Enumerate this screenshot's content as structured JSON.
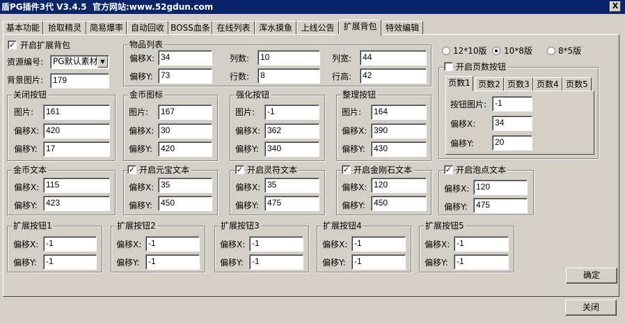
{
  "title": "盾PG插件3代 V3.4.5  官方网站:www.52gdun.com",
  "close_glyph": "X",
  "tabs": [
    "基本功能",
    "拾取精灵",
    "简易爆率",
    "自动回收",
    "BOSS血条",
    "在线列表",
    "浑水摸鱼",
    "上线公告",
    "扩展背包",
    "特效编辑"
  ],
  "active_tab": "扩展背包",
  "enable_bag": {
    "label": "开启扩展背包",
    "checked": true,
    "mark": "✓"
  },
  "resource": {
    "label": "资源编号:",
    "value": "PG默认素材",
    "arrow": "▼"
  },
  "bg_image": {
    "label": "背景图片:",
    "value": "179"
  },
  "item_list": {
    "title": "物品列表",
    "offset_x_label": "偏移X:",
    "offset_x": "34",
    "offset_y_label": "偏移Y:",
    "offset_y": "73",
    "cols_label": "列数:",
    "cols": "10",
    "rows_label": "行数:",
    "rows": "8",
    "col_width_label": "列宽:",
    "col_width": "44",
    "row_height_label": "行高:",
    "row_height": "42"
  },
  "close_button_grp": {
    "title": "关闭按钮",
    "img_label": "图片:",
    "img": "161",
    "x_label": "偏移X:",
    "x": "420",
    "y_label": "偏移Y:",
    "y": "17"
  },
  "gold_icon": {
    "title": "金币图标",
    "img_label": "图片:",
    "img": "167",
    "x_label": "偏移X:",
    "x": "30",
    "y_label": "偏移Y:",
    "y": "420"
  },
  "enhance_btn": {
    "title": "强化按钮",
    "img_label": "图片:",
    "img": "-1",
    "x_label": "偏移X:",
    "x": "362",
    "y_label": "偏移Y:",
    "y": "340"
  },
  "sort_btn": {
    "title": "整理按钮",
    "img_label": "图片:",
    "img": "164",
    "x_label": "偏移X:",
    "x": "390",
    "y_label": "偏移Y:",
    "y": "430"
  },
  "gold_text": {
    "title": "金币文本",
    "x_label": "偏移X:",
    "x": "115",
    "y_label": "偏移Y:",
    "y": "423"
  },
  "yuanbao_text": {
    "title": "开启元宝文本",
    "checked": true,
    "x_label": "偏移X:",
    "x": "35",
    "y_label": "偏移Y:",
    "y": "450"
  },
  "lingfu_text": {
    "title": "开启灵符文本",
    "checked": true,
    "x_label": "偏移X:",
    "x": "35",
    "y_label": "偏移Y:",
    "y": "475"
  },
  "diamond_text": {
    "title": "开启金刚石文本",
    "checked": true,
    "x_label": "偏移X:",
    "x": "120",
    "y_label": "偏移Y:",
    "y": "450"
  },
  "bubble_text": {
    "title": "开启泡点文本",
    "checked": true,
    "x_label": "偏移X:",
    "x": "120",
    "y_label": "偏移Y:",
    "y": "475"
  },
  "layout_options": [
    {
      "label": "12*10版",
      "selected": false
    },
    {
      "label": "10*8版",
      "selected": true
    },
    {
      "label": "8*5版",
      "selected": false
    }
  ],
  "page_buttons": {
    "title": "开启页数按钮",
    "checked": false,
    "tabs": [
      "页数1",
      "页数2",
      "页数3",
      "页数4",
      "页数5"
    ],
    "active": "页数1",
    "img_label": "按钮图片:",
    "img": "-1",
    "x_label": "偏移X:",
    "x": "34",
    "y_label": "偏移Y:",
    "y": "20"
  },
  "ext_buttons": [
    {
      "title": "扩展按钮1",
      "x_label": "偏移X:",
      "x": "-1",
      "y_label": "偏移Y:",
      "y": "-1"
    },
    {
      "title": "扩展按钮2",
      "x_label": "偏移X:",
      "x": "-1",
      "y_label": "偏移Y:",
      "y": "-1"
    },
    {
      "title": "扩展按钮3",
      "x_label": "偏移X:",
      "x": "-1",
      "y_label": "偏移Y:",
      "y": "-1"
    },
    {
      "title": "扩展按钮4",
      "x_label": "偏移X:",
      "x": "-1",
      "y_label": "偏移Y:",
      "y": "-1"
    },
    {
      "title": "扩展按钮5",
      "x_label": "偏移X:",
      "x": "-1",
      "y_label": "偏移Y:",
      "y": "-1"
    }
  ],
  "confirm_label": "确定",
  "close_label": "关闭"
}
